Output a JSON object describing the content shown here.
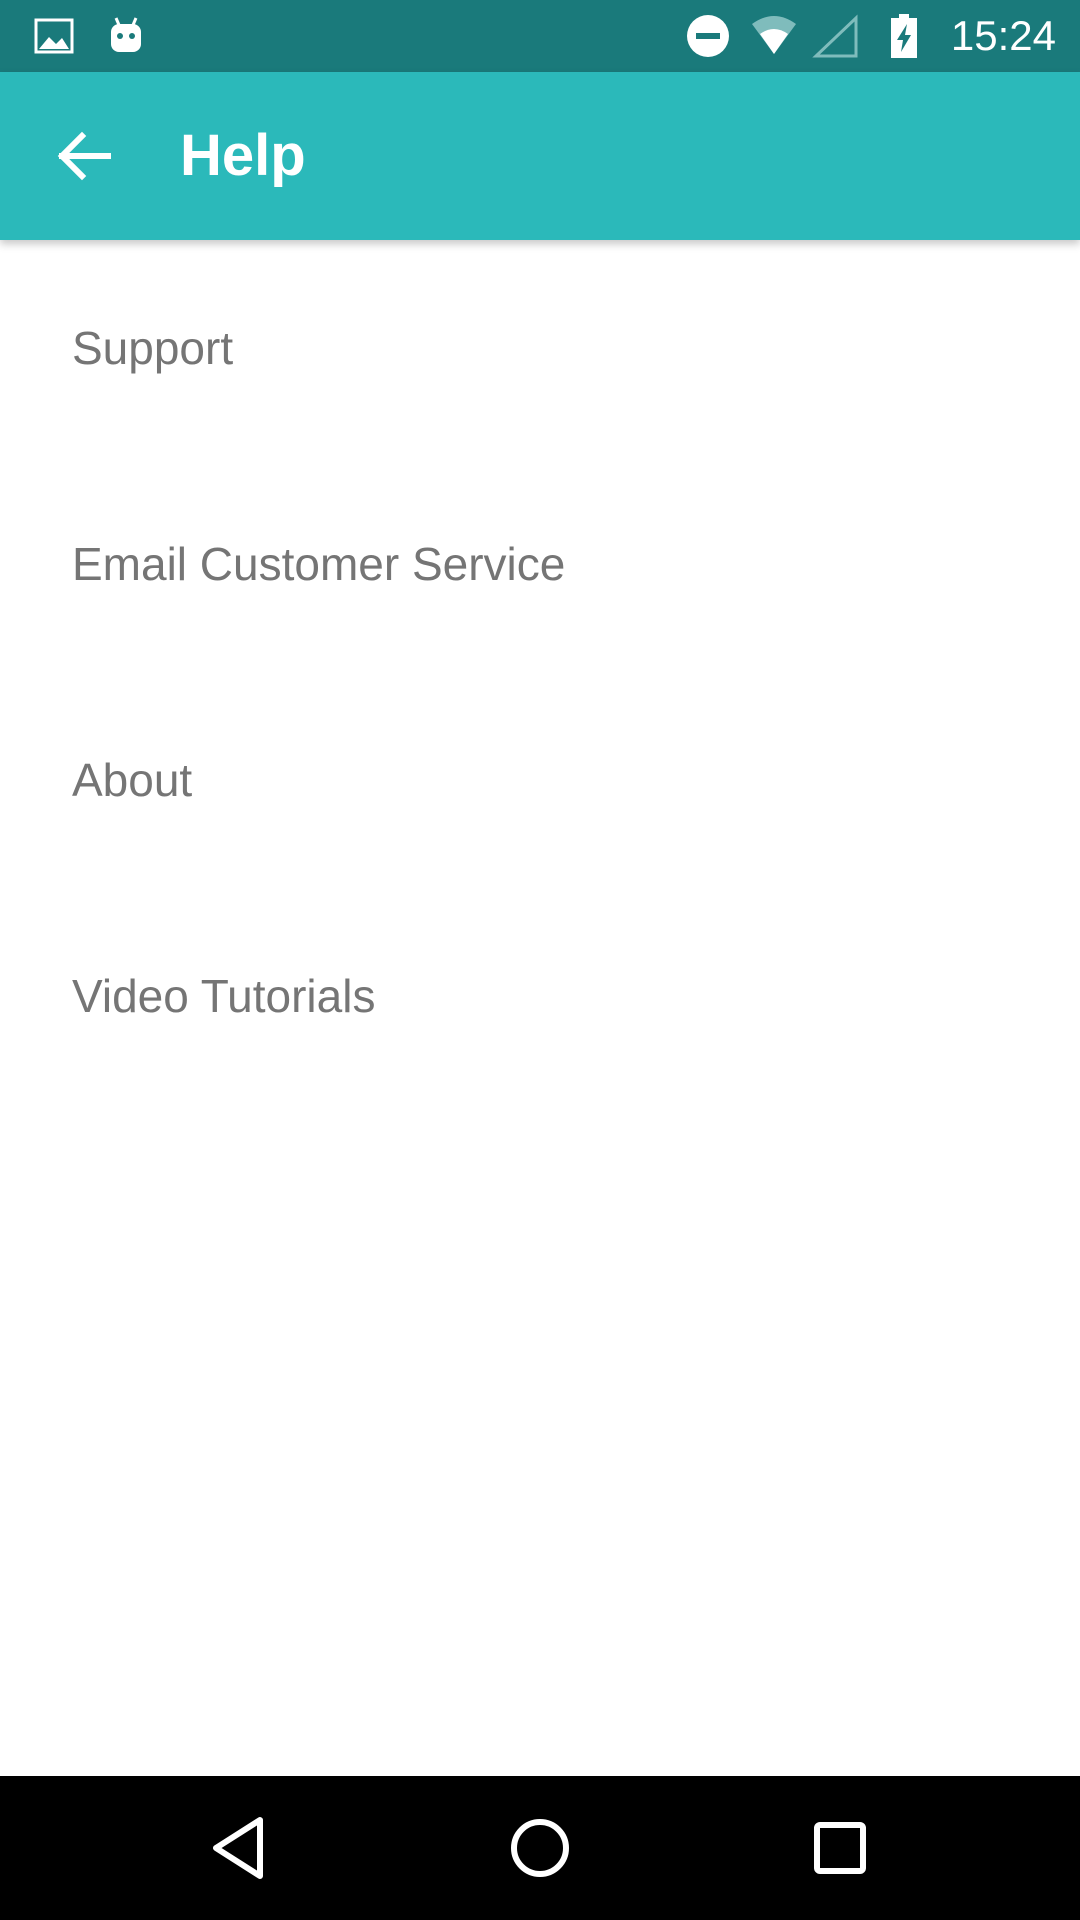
{
  "status_bar": {
    "time": "15:24",
    "icons": [
      "image-icon",
      "android-icon",
      "do-not-disturb-icon",
      "wifi-icon",
      "cell-signal-icon",
      "battery-charging-icon"
    ],
    "color": "#1a7a7b"
  },
  "app_bar": {
    "title": "Help",
    "back_icon": "arrow-back-icon",
    "color": "#2bb9ba"
  },
  "menu": {
    "items": [
      {
        "label": "Support"
      },
      {
        "label": "Email Customer Service"
      },
      {
        "label": "About"
      },
      {
        "label": "Video Tutorials"
      }
    ],
    "text_color": "#757575"
  },
  "nav_bar": {
    "buttons": [
      "back-triangle-icon",
      "home-circle-icon",
      "recents-square-icon"
    ]
  }
}
